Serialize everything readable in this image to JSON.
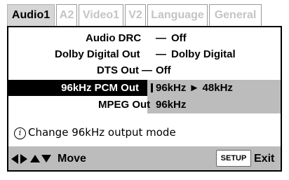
{
  "tabs": [
    {
      "label": "Audio1",
      "active": true
    },
    {
      "label": "A2",
      "active": false
    },
    {
      "label": "Video1",
      "active": false
    },
    {
      "label": "V2",
      "active": false
    },
    {
      "label": "Language",
      "active": false
    },
    {
      "label": "General",
      "active": false
    }
  ],
  "settings": {
    "audio_drc": {
      "label": "Audio DRC",
      "separator": "—",
      "value": "Off"
    },
    "dolby_digital_out": {
      "label": "Dolby Digital Out",
      "separator": "—",
      "value": "Dolby Digital"
    },
    "dts_out": {
      "label": "DTS Out",
      "separator": "—",
      "value": "Off"
    },
    "pcm_96khz_out": {
      "label": "96kHz PCM Out",
      "options": [
        "96kHz ► 48kHz",
        "96kHz"
      ],
      "selected": "96kHz ► 48kHz"
    },
    "mpeg_out": {
      "label": "MPEG Out"
    }
  },
  "hint": {
    "icon": "info-icon",
    "text": "Change 96kHz output mode"
  },
  "footer": {
    "nav_icons": [
      "arrow-left-icon",
      "arrow-right-icon",
      "arrow-up-icon",
      "arrow-down-icon"
    ],
    "move_label": "Move",
    "setup_key": "SETUP",
    "exit_label": "Exit"
  },
  "colors": {
    "tab_active_bg": "#d6d6d6",
    "tab_inactive_text": "#c4c4c4",
    "highlight_bg": "#000000",
    "option_bg": "#bcbcbc",
    "footer_bg": "#bcbcbc"
  }
}
